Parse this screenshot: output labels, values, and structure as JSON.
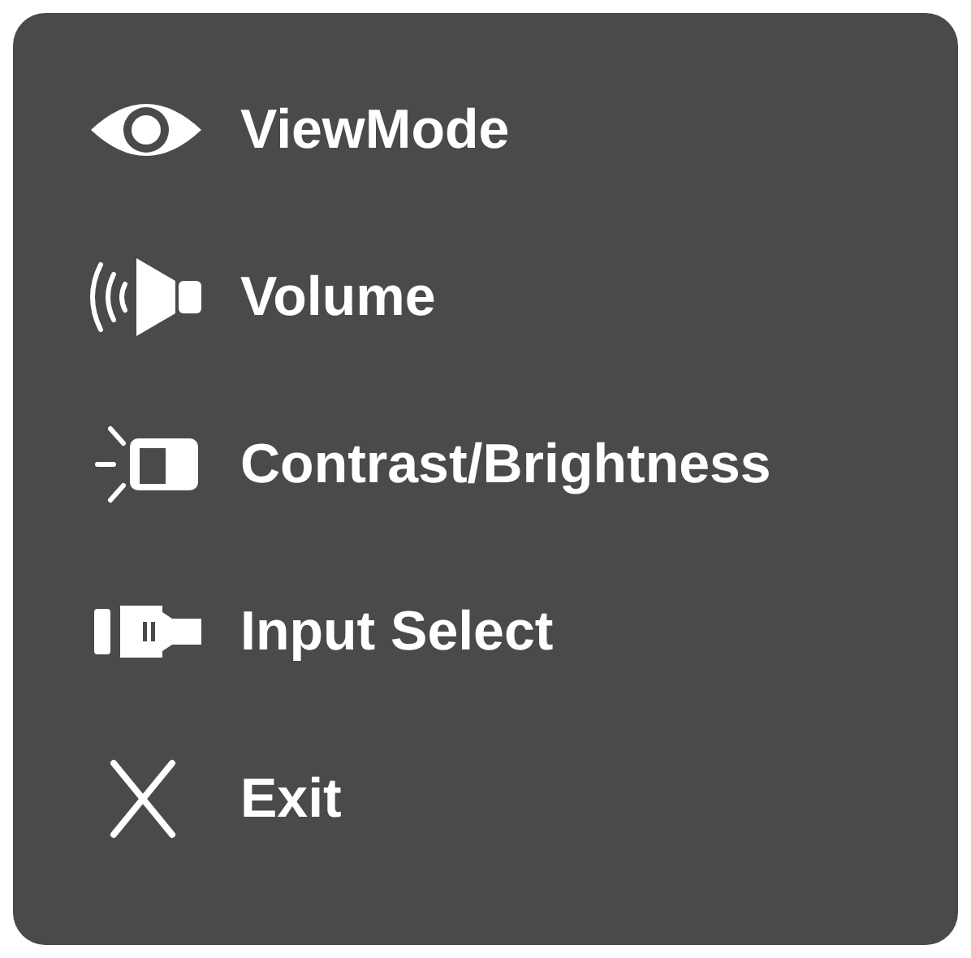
{
  "menu": {
    "items": [
      {
        "kind": "eye",
        "label": "ViewMode"
      },
      {
        "kind": "speaker",
        "label": "Volume"
      },
      {
        "kind": "brightness",
        "label": "Contrast/Brightness"
      },
      {
        "kind": "plug",
        "label": "Input Select"
      },
      {
        "kind": "close",
        "label": "Exit"
      }
    ]
  }
}
